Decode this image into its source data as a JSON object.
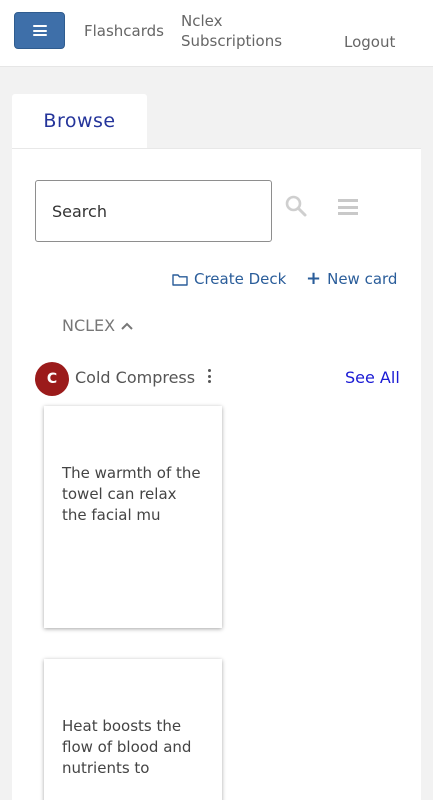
{
  "nav": {
    "flashcards": "Flashcards",
    "nclex_subscriptions": "Nclex Subscriptions",
    "logout": "Logout",
    "menu_icon": "hamburger-icon"
  },
  "tabs": [
    {
      "label": "Browse"
    }
  ],
  "search": {
    "placeholder": "Search"
  },
  "actions": {
    "create_deck": "Create Deck",
    "new_card": "New card"
  },
  "deck_group": {
    "label": "NCLEX"
  },
  "deck": {
    "avatar_letter": "C",
    "name": "Cold Compress",
    "see_all": "See All",
    "cards": [
      {
        "text": "The warmth of the towel can relax the facial mu"
      },
      {
        "text": "Heat boosts the flow of blood and nutrients to"
      }
    ]
  },
  "colors": {
    "menu_button": "#3e6fa9",
    "tab_text": "#24349a",
    "link": "#2a5d9a",
    "see_all": "#1a1ad4",
    "avatar": "#9b1b1b",
    "background": "#f2f2f2"
  }
}
